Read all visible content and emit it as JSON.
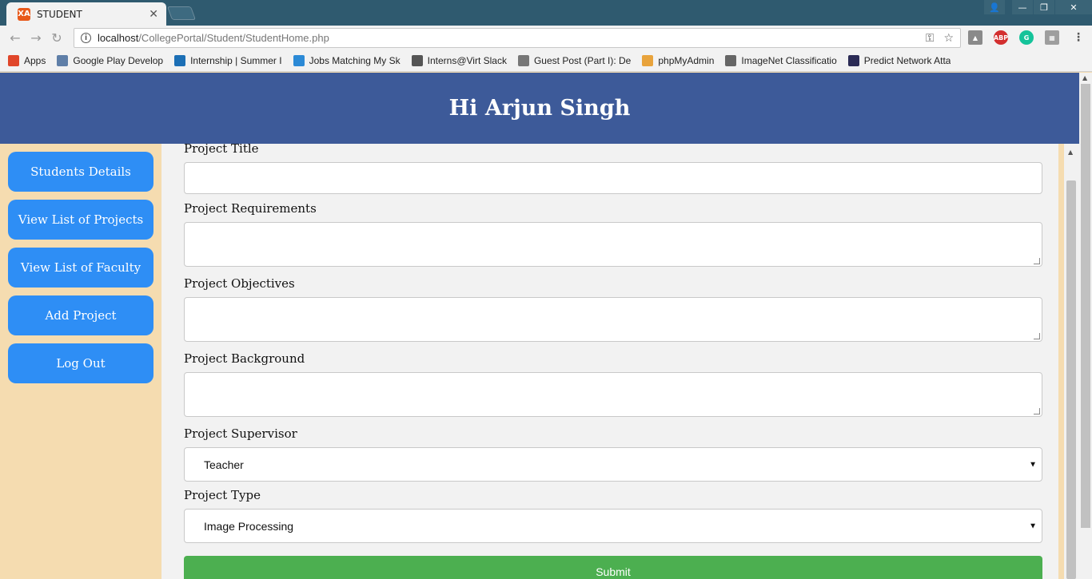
{
  "browser": {
    "tab_title": "STUDENT",
    "tab_favicon": "XA",
    "url_host": "localhost",
    "url_path": "/CollegePortal/Student/StudentHome.php",
    "bookmarks": [
      {
        "label": "Apps",
        "color": "#e0462a"
      },
      {
        "label": "Google Play Develop",
        "color": "#5f7fa8"
      },
      {
        "label": "Internship | Summer I",
        "color": "#1c6fb5"
      },
      {
        "label": "Jobs Matching My Sk",
        "color": "#2c8ad6"
      },
      {
        "label": "Interns@Virt Slack",
        "color": "#555555"
      },
      {
        "label": "Guest Post (Part I): De",
        "color": "#777777"
      },
      {
        "label": "phpMyAdmin",
        "color": "#e8a33c"
      },
      {
        "label": "ImageNet Classificatio",
        "color": "#666666"
      },
      {
        "label": "Predict Network Atta",
        "color": "#2b2b55"
      }
    ],
    "ext_abp": "ABP"
  },
  "header": {
    "greeting": "Hi Arjun Singh"
  },
  "sidebar": {
    "items": [
      {
        "label": "Students Details"
      },
      {
        "label": "View List of Projects"
      },
      {
        "label": "View List of Faculty"
      },
      {
        "label": "Add Project"
      },
      {
        "label": "Log Out"
      }
    ]
  },
  "form": {
    "title_label": "Project Title",
    "requirements_label": "Project Requirements",
    "objectives_label": "Project Objectives",
    "background_label": "Project Background",
    "supervisor_label": "Project Supervisor",
    "supervisor_value": "Teacher",
    "type_label": "Project Type",
    "type_value": "Image Processing",
    "submit_label": "Submit"
  },
  "colors": {
    "header": "#3d5a99",
    "sidebar_bg": "#f5dcb0",
    "sidebar_button": "#2e8ef5",
    "submit": "#4caf50"
  }
}
